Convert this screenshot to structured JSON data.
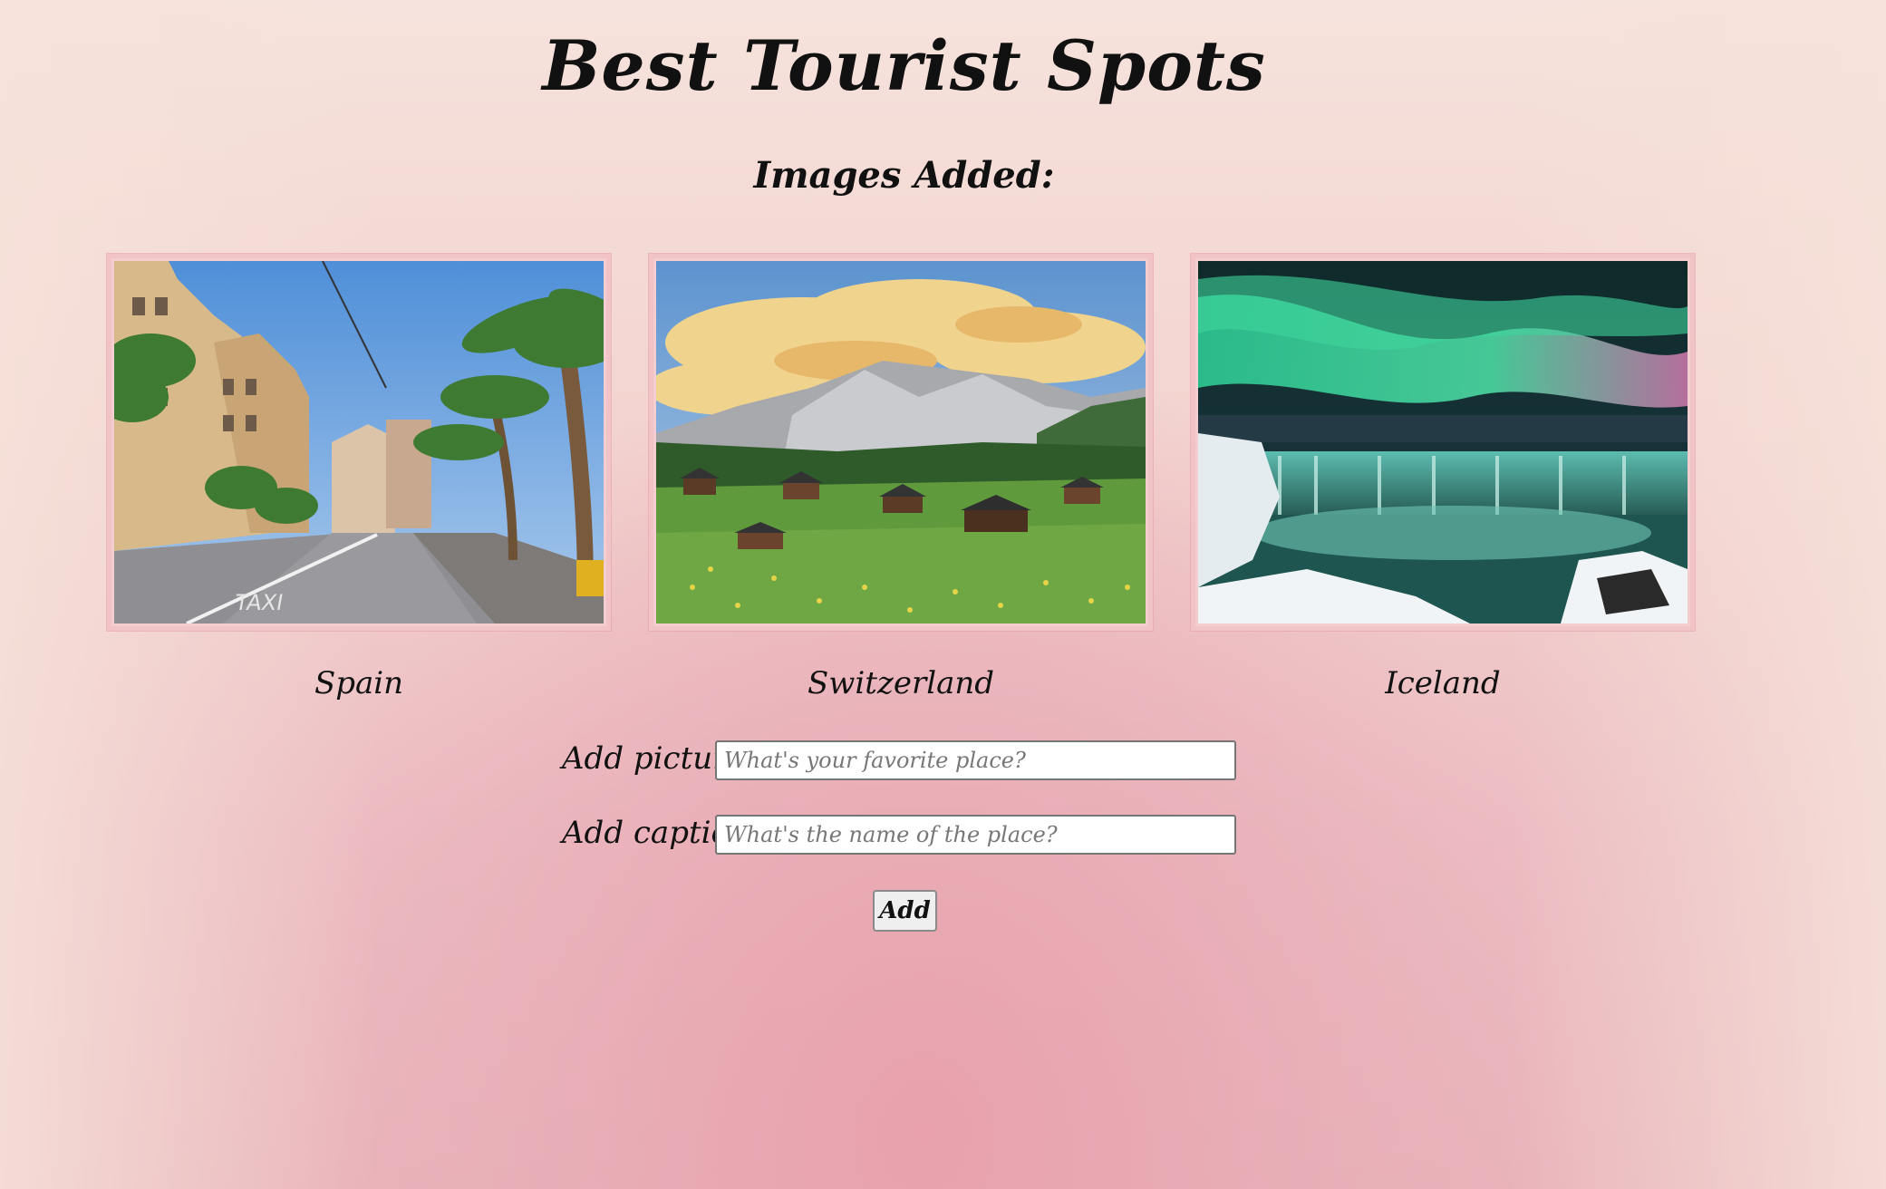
{
  "page": {
    "title": "Best Tourist Spots",
    "section_title": "Images Added:"
  },
  "gallery": {
    "items": [
      {
        "caption": "Spain",
        "image": "spain-street-palm-trees-photo"
      },
      {
        "caption": "Switzerland",
        "image": "switzerland-alpine-village-photo"
      },
      {
        "caption": "Iceland",
        "image": "iceland-aurora-waterfall-photo"
      }
    ]
  },
  "form": {
    "picture_label": "Add picture:",
    "picture_placeholder": "What's your favorite place?",
    "picture_value": "",
    "caption_label": "Add caption:",
    "caption_placeholder": "What's the name of the place?",
    "caption_value": "",
    "add_label": "Add"
  },
  "colors": {
    "frame_border": "#f1c3c6",
    "background_top": "#f6e2dc",
    "background_bottom": "#e9b4bb"
  }
}
